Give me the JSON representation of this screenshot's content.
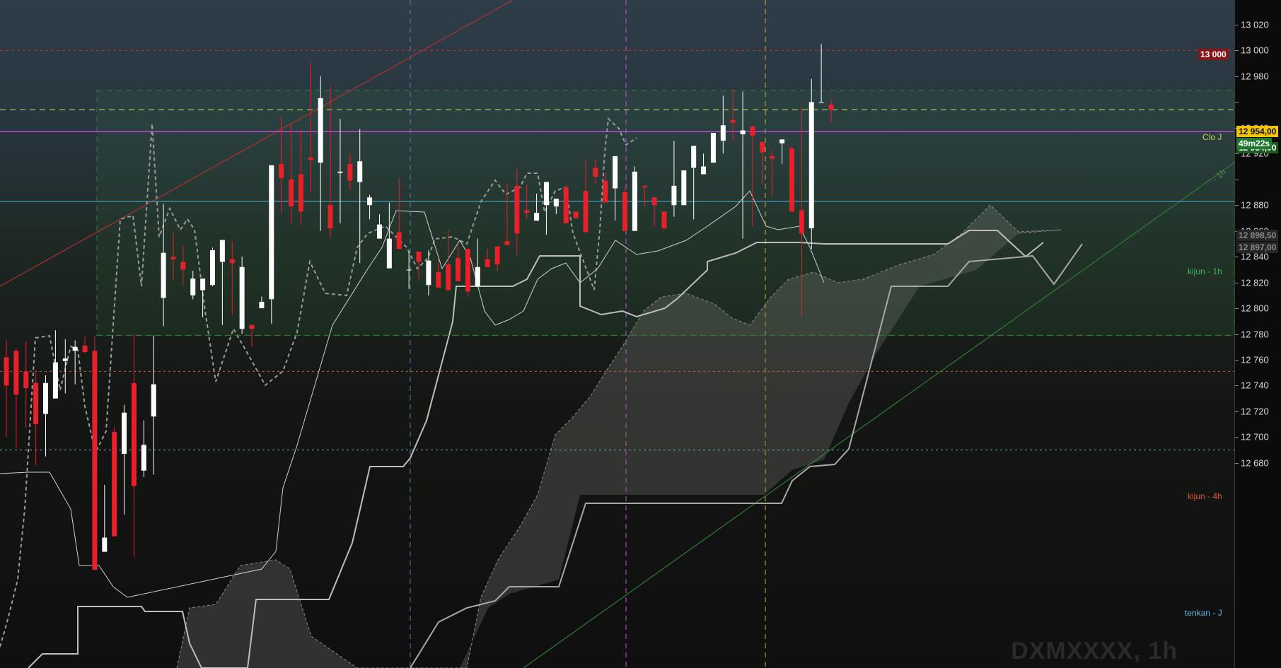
{
  "chart_title": "DXMXXXX, 1h",
  "price_axis": {
    "ticks": [
      13020,
      13000,
      12980,
      12960,
      12940,
      12920,
      12900,
      12880,
      12860,
      12840,
      12820,
      12800,
      12780,
      12760,
      12740,
      12720,
      12700,
      12680
    ],
    "tick_labels": [
      "13 020",
      "13 000",
      "12 980",
      "",
      "12 940",
      "12 920",
      "",
      "12 880",
      "12 860",
      "12 840",
      "12 820",
      "12 800",
      "12 780",
      "12 760",
      "12 740",
      "12 720",
      "12 700",
      "12 680"
    ],
    "badges": {
      "level_13000": "13 000",
      "last_price": "12 954,00",
      "countdown": "49m22s",
      "hidden_price": "12 954,00",
      "upper_gray": "12 898,50",
      "lower_gray": "12 897,00"
    }
  },
  "line_labels": {
    "clo_j": "Clo J",
    "one_h": "- 1h",
    "kijun_1h": "kijun - 1h",
    "kijun_4h": "kijun - 4h",
    "tenkan_j": "tenkan - J"
  },
  "colors": {
    "bull": "#ffffff",
    "bear": "#e8202a",
    "clo_j": "#c7d45a",
    "magenta": "#c84fd8",
    "kijun_1h": "#5ab4e0",
    "kijun_4h": "#d85a2a",
    "tenkan_j": "#7aa6d8",
    "level_13000": "#c0272d",
    "green_zone": "#2f7a3a",
    "countdown_bg": "#1f7a30"
  },
  "chart_data": {
    "type": "candlestick",
    "title": "DXMXXXX, 1h",
    "ylim": [
      12661,
      13036
    ],
    "horizontal_levels": [
      {
        "label": "13 000",
        "value": 13000
      },
      {
        "label": "Clo J",
        "value": 12954
      },
      {
        "label": "",
        "value": 12937
      },
      {
        "label": "kijun - 1h",
        "value": 12883
      },
      {
        "label": "kijun - 4h",
        "value": 12751
      },
      {
        "label": "tenkan - J",
        "value": 12690
      }
    ],
    "candles": [
      [
        12762,
        12775,
        12700,
        12740
      ],
      [
        12767,
        12769,
        12692,
        12733
      ],
      [
        12751,
        12774,
        12707,
        12738
      ],
      [
        12742,
        12750,
        12678,
        12710
      ],
      [
        12718,
        12748,
        12685,
        12742
      ],
      [
        12730,
        12783,
        12736,
        12758
      ],
      [
        12759,
        12776,
        12734,
        12761
      ],
      [
        12767,
        12775,
        12741,
        12770
      ],
      [
        12771,
        12778,
        12765,
        12766
      ],
      [
        12767,
        12778,
        12598,
        12597
      ],
      [
        12611,
        12663,
        12624,
        12622
      ],
      [
        12704,
        12708,
        12624,
        12623
      ],
      [
        12687,
        12725,
        12640,
        12719
      ],
      [
        12742,
        12780,
        12607,
        12662
      ],
      [
        12674,
        12713,
        12669,
        12694
      ],
      [
        12716,
        12779,
        12671,
        12741
      ],
      [
        12808,
        12881,
        12786,
        12843
      ],
      [
        12840,
        12859,
        12822,
        12838
      ],
      [
        12836,
        12848,
        12818,
        12830
      ],
      [
        12810,
        12829,
        12807,
        12823
      ],
      [
        12814,
        12821,
        12793,
        12823
      ],
      [
        12818,
        12847,
        12817,
        12845
      ],
      [
        12836,
        12852,
        12787,
        12853
      ],
      [
        12838,
        12852,
        12795,
        12835
      ],
      [
        12784,
        12840,
        12780,
        12832
      ],
      [
        12787,
        12785,
        12770,
        12784
      ],
      [
        12800,
        12809,
        12801,
        12805
      ],
      [
        12807,
        12861,
        12788,
        12911
      ],
      [
        12912,
        12949,
        12874,
        12901
      ],
      [
        12900,
        12943,
        12866,
        12879
      ],
      [
        12904,
        12938,
        12865,
        12875
      ],
      [
        12917,
        12991,
        12890,
        12915
      ],
      [
        12913,
        12980,
        12860,
        12963
      ],
      [
        12880,
        12972,
        12855,
        12862
      ],
      [
        12905,
        12947,
        12866,
        12906
      ],
      [
        12912,
        12920,
        12892,
        12899
      ],
      [
        12898,
        12939,
        12835,
        12914
      ],
      [
        12880,
        12888,
        12869,
        12886
      ],
      [
        12854,
        12873,
        12880,
        12865
      ],
      [
        12831,
        12882,
        12840,
        12854
      ],
      [
        12859,
        12901,
        12852,
        12846
      ],
      [
        12830,
        12844,
        12815,
        12830
      ],
      [
        12844,
        12839,
        12823,
        12836
      ],
      [
        12818,
        12845,
        12810,
        12837
      ],
      [
        12828,
        12838,
        12822,
        12816
      ],
      [
        12834,
        12861,
        12839,
        12814
      ],
      [
        12839,
        12849,
        12836,
        12821
      ],
      [
        12846,
        12841,
        12809,
        12813
      ],
      [
        12817,
        12854,
        12820,
        12832
      ],
      [
        12838,
        12846,
        12835,
        12832
      ],
      [
        12848,
        12843,
        12829,
        12834
      ],
      [
        12852,
        12897,
        12865,
        12849
      ],
      [
        12895,
        12908,
        12841,
        12858
      ],
      [
        12876,
        12896,
        12869,
        12874
      ],
      [
        12868,
        12889,
        12882,
        12874
      ],
      [
        12880,
        12897,
        12857,
        12898
      ],
      [
        12879,
        12880,
        12873,
        12885
      ],
      [
        12894,
        12892,
        12896,
        12866
      ],
      [
        12875,
        12874,
        12869,
        12870
      ],
      [
        12891,
        12915,
        12902,
        12859
      ],
      [
        12909,
        12915,
        12896,
        12902
      ],
      [
        12899,
        12905,
        12905,
        12882
      ],
      [
        12893,
        12872,
        12868,
        12918
      ],
      [
        12890,
        12894,
        12878,
        12860
      ],
      [
        12860,
        12910,
        12867,
        12906
      ],
      [
        12895,
        12869,
        12879,
        12894
      ],
      [
        12886,
        12870,
        12864,
        12880
      ],
      [
        12875,
        12858,
        12863,
        12862
      ],
      [
        12880,
        12930,
        12871,
        12895
      ],
      [
        12880,
        12895,
        12881,
        12907
      ],
      [
        12909,
        12925,
        12869,
        12926
      ],
      [
        12904,
        12920,
        12921,
        12910
      ],
      [
        12913,
        12935,
        12917,
        12936
      ],
      [
        12930,
        12965,
        12920,
        12942
      ],
      [
        12946,
        12970,
        12930,
        12944
      ],
      [
        12935,
        12968,
        12854,
        12938
      ],
      [
        12941,
        12942,
        12864,
        12934
      ],
      [
        12929,
        12927,
        12896,
        12921
      ],
      [
        12918,
        12922,
        12887,
        12916
      ],
      [
        12928,
        12931,
        12912,
        12931
      ],
      [
        12924,
        12926,
        12919,
        12875
      ],
      [
        12876,
        12956,
        12793,
        12858
      ],
      [
        12862,
        12978,
        12846,
        12960
      ],
      [
        12960,
        13005,
        12960,
        12960
      ],
      [
        12958,
        12962,
        12944,
        12954
      ]
    ]
  }
}
